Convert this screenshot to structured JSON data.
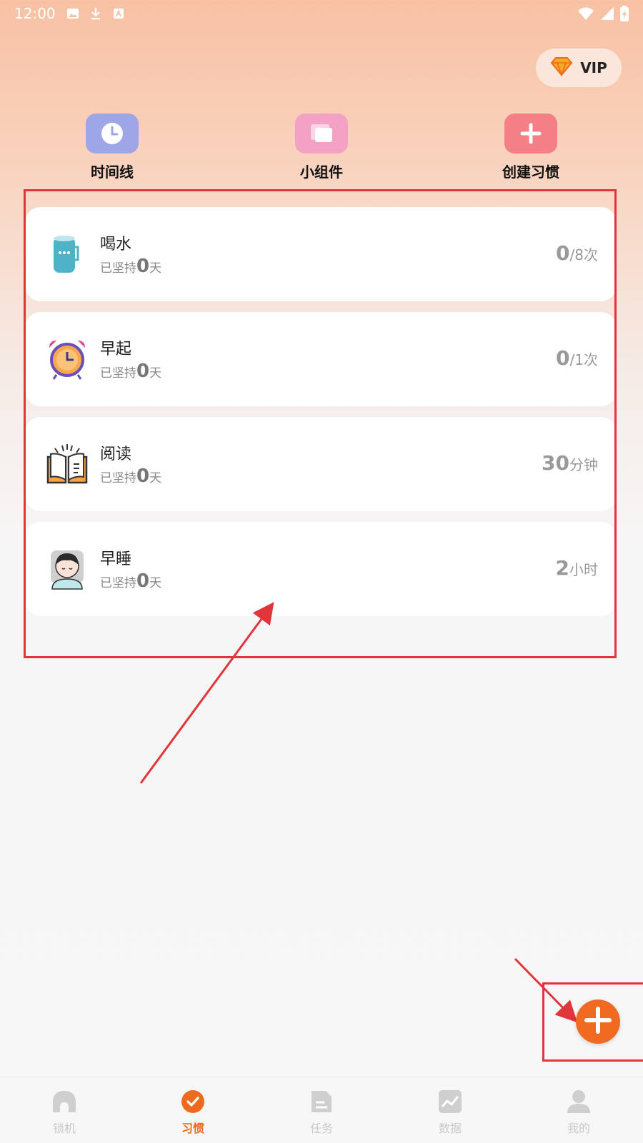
{
  "status_bar": {
    "time": "12:00"
  },
  "vip": {
    "label": "VIP"
  },
  "quick_actions": [
    {
      "label": "时间线",
      "icon": "clock-icon",
      "color": "#9ea6e8"
    },
    {
      "label": "小组件",
      "icon": "widget-icon",
      "color": "#f3a2c6"
    },
    {
      "label": "创建习惯",
      "icon": "plus-icon",
      "color": "#f57f86"
    }
  ],
  "habits": [
    {
      "title": "喝水",
      "sub_prefix": "已坚持",
      "streak": "0",
      "sub_suffix": "天",
      "value": "0",
      "unit": "/8次",
      "icon": "cup-icon"
    },
    {
      "title": "早起",
      "sub_prefix": "已坚持",
      "streak": "0",
      "sub_suffix": "天",
      "value": "0",
      "unit": "/1次",
      "icon": "alarm-clock-icon"
    },
    {
      "title": "阅读",
      "sub_prefix": "已坚持",
      "streak": "0",
      "sub_suffix": "天",
      "value": "30",
      "unit": "分钟",
      "icon": "book-icon"
    },
    {
      "title": "早睡",
      "sub_prefix": "已坚持",
      "streak": "0",
      "sub_suffix": "天",
      "value": "2",
      "unit": "小时",
      "icon": "sleeping-person-icon"
    }
  ],
  "nav": [
    {
      "label": "锁机",
      "icon": "lock-icon",
      "active": false
    },
    {
      "label": "习惯",
      "icon": "check-circle-icon",
      "active": true
    },
    {
      "label": "任务",
      "icon": "document-icon",
      "active": false
    },
    {
      "label": "数据",
      "icon": "chart-icon",
      "active": false
    },
    {
      "label": "我的",
      "icon": "user-icon",
      "active": false
    }
  ],
  "colors": {
    "accent": "#ef6a1f",
    "annotation": "#e0353b"
  }
}
